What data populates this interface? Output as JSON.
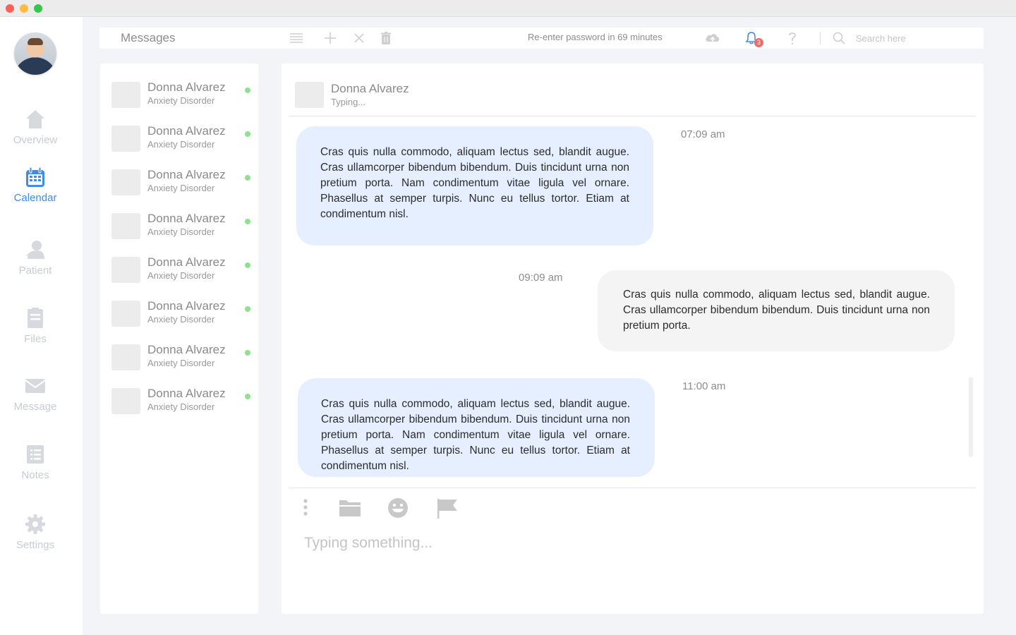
{
  "window": {
    "controls": [
      "close",
      "minimize",
      "maximize"
    ]
  },
  "sidebar": {
    "avatar_alt": "",
    "items": [
      {
        "label": "Overview",
        "icon": "home-icon",
        "active": false
      },
      {
        "label": "Calendar",
        "icon": "calendar-icon",
        "active": true
      },
      {
        "label": "Patient",
        "icon": "patient-icon",
        "active": false
      },
      {
        "label": "Files",
        "icon": "files-icon",
        "active": false
      },
      {
        "label": "Message",
        "icon": "envelope-icon",
        "active": false
      },
      {
        "label": "Notes",
        "icon": "notes-icon",
        "active": false
      },
      {
        "label": "Settings",
        "icon": "gear-icon",
        "active": false
      }
    ]
  },
  "topbar": {
    "title": "Messages",
    "icons": [
      "list-icon",
      "plus-icon",
      "close-icon",
      "trash-icon"
    ],
    "password_notice": "Re-enter password in 69 minutes",
    "notification_count": "3",
    "search_placeholder": "Search here"
  },
  "contacts": [
    {
      "name": "Donna Alvarez",
      "condition": "Anxiety Disorder",
      "online": true
    },
    {
      "name": "Donna Alvarez",
      "condition": "Anxiety Disorder",
      "online": true
    },
    {
      "name": "Donna Alvarez",
      "condition": "Anxiety Disorder",
      "online": true
    },
    {
      "name": "Donna Alvarez",
      "condition": "Anxiety Disorder",
      "online": true
    },
    {
      "name": "Donna Alvarez",
      "condition": "Anxiety Disorder",
      "online": true
    },
    {
      "name": "Donna Alvarez",
      "condition": "Anxiety Disorder",
      "online": true
    },
    {
      "name": "Donna Alvarez",
      "condition": "Anxiety Disorder",
      "online": true
    },
    {
      "name": "Donna Alvarez",
      "condition": "Anxiety Disorder",
      "online": true
    }
  ],
  "chat": {
    "header": {
      "name": "Donna Alvarez",
      "status": "Typing..."
    },
    "messages": [
      {
        "direction": "in",
        "time": "07:09 am",
        "text": "Cras quis nulla commodo, aliquam lectus sed, blandit augue. Cras ullamcorper bibendum bibendum. Duis tincidunt urna non pretium porta. Nam condimentum vitae ligula vel ornare. Phasellus at semper turpis. Nunc eu tellus tortor. Etiam at condimentum nisl."
      },
      {
        "direction": "out",
        "time": "09:09 am",
        "text": "Cras quis nulla commodo, aliquam lectus sed, blandit augue. Cras ullamcorper bibendum bibendum. Duis tincidunt urna non pretium porta."
      },
      {
        "direction": "in",
        "time": "11:00 am",
        "text": "Cras quis nulla commodo, aliquam lectus sed, blandit augue. Cras ullamcorper bibendum bibendum. Duis tincidunt urna non pretium porta. Nam condimentum vitae ligula vel ornare. Phasellus at semper turpis. Nunc eu tellus tortor. Etiam at condimentum nisl."
      }
    ],
    "composer": {
      "icons": [
        "more-vertical-icon",
        "folder-icon",
        "emoji-icon",
        "flag-icon"
      ],
      "placeholder": "Typing something..."
    }
  },
  "colors": {
    "accent": "#3f8be8",
    "incoming_bubble": "#e5efff",
    "outgoing_bubble": "#f4f4f4",
    "online_dot": "#8fe08f",
    "badge": "#f06a6a",
    "background": "#f2f4f8"
  }
}
